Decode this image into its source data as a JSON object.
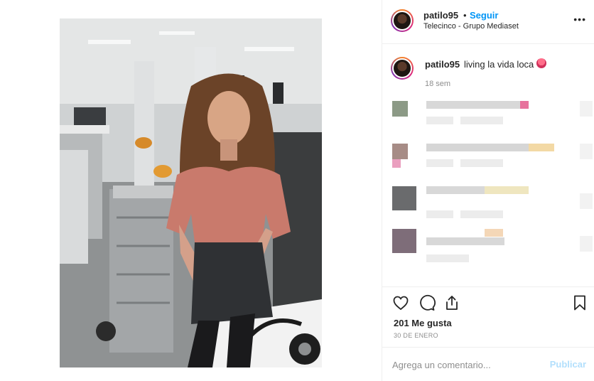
{
  "post": {
    "username": "patilo95",
    "separator": "•",
    "follow_label": "Seguir",
    "location": "Telecinco - Grupo Mediaset",
    "more_icon": "more-horizontal-icon"
  },
  "caption": {
    "username": "patilo95",
    "text": "living la vida loca",
    "emoji": "tongue-emoji",
    "time": "18 sem"
  },
  "actions": {
    "like_icon": "heart-icon",
    "comment_icon": "comment-icon",
    "share_icon": "share-icon",
    "save_icon": "bookmark-icon",
    "likes": "201 Me gusta",
    "date": "30 DE ENERO"
  },
  "comment_box": {
    "placeholder": "Agrega un comentario...",
    "publish_label": "Publicar"
  },
  "colors": {
    "link_blue": "#0095f6",
    "publish_disabled": "#b2dffc",
    "muted": "#8e8e8e"
  }
}
